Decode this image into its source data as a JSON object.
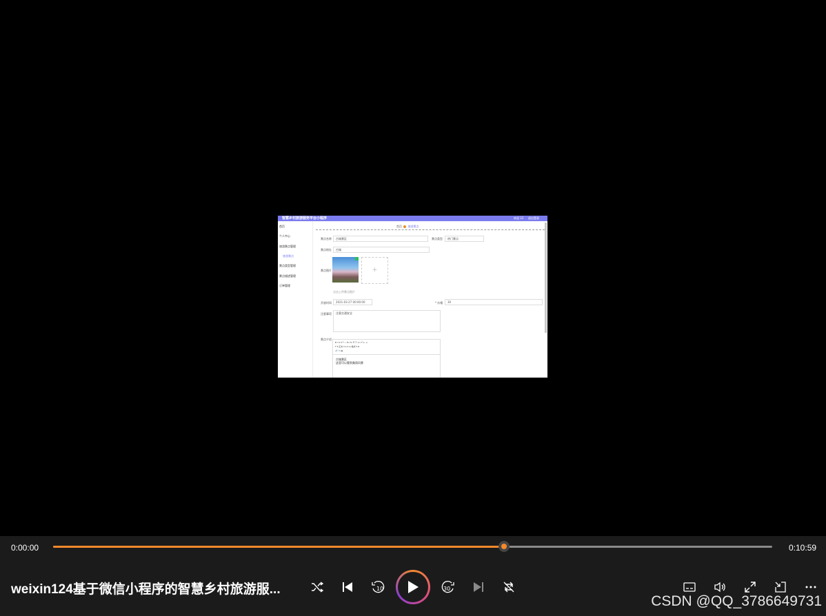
{
  "video": {
    "title": "weixin124基于微信小程序的智慧乡村旅游服...",
    "current_time": "0:00:00",
    "total_time": "0:10:59",
    "progress": 0.627
  },
  "frame": {
    "header_title": "智慧乡村旅游服务平台小程序",
    "header_right_1": "欢迎 22",
    "header_right_2": "退出登录",
    "sidebar": [
      "首页",
      "个人中心",
      "旅游景点管理",
      "旅游景点",
      "景点类型管理",
      "景点描述管理",
      "订单管理"
    ],
    "breadcrumb_home": "首页",
    "breadcrumb_current": "旅游景点",
    "fields": {
      "name_label": "景点名称",
      "name_value": "古城景区",
      "type_label": "景点类型",
      "type_value": "热门景点",
      "addr_label": "景点地址",
      "addr_value": "古城",
      "image_label": "景点图片",
      "image_hint": "点击上传景点图片",
      "time_label": "开放时间",
      "time_value": "2021-03-27 00:00:00",
      "price_label": "* 价格",
      "price_value": "30",
      "notice_label": "注意事项",
      "notice_value": "注意交通安全",
      "intro_label": "景点介绍",
      "intro_line1": "古城景区",
      "intro_line2": "这里可以看到美丽风景"
    },
    "plus": "+"
  },
  "watermark": "CSDN @QQ_3786649731",
  "icons": [
    "shuffle-icon",
    "previous-icon",
    "rewind-10-icon",
    "play-icon",
    "forward-30-icon",
    "next-icon",
    "repeat-off-icon",
    "subtitles-icon",
    "volume-icon",
    "fullscreen-icon",
    "mini-player-icon",
    "more-icon"
  ],
  "colors": {
    "accent": "#f5892a",
    "frame_header": "#7b7cf0"
  }
}
